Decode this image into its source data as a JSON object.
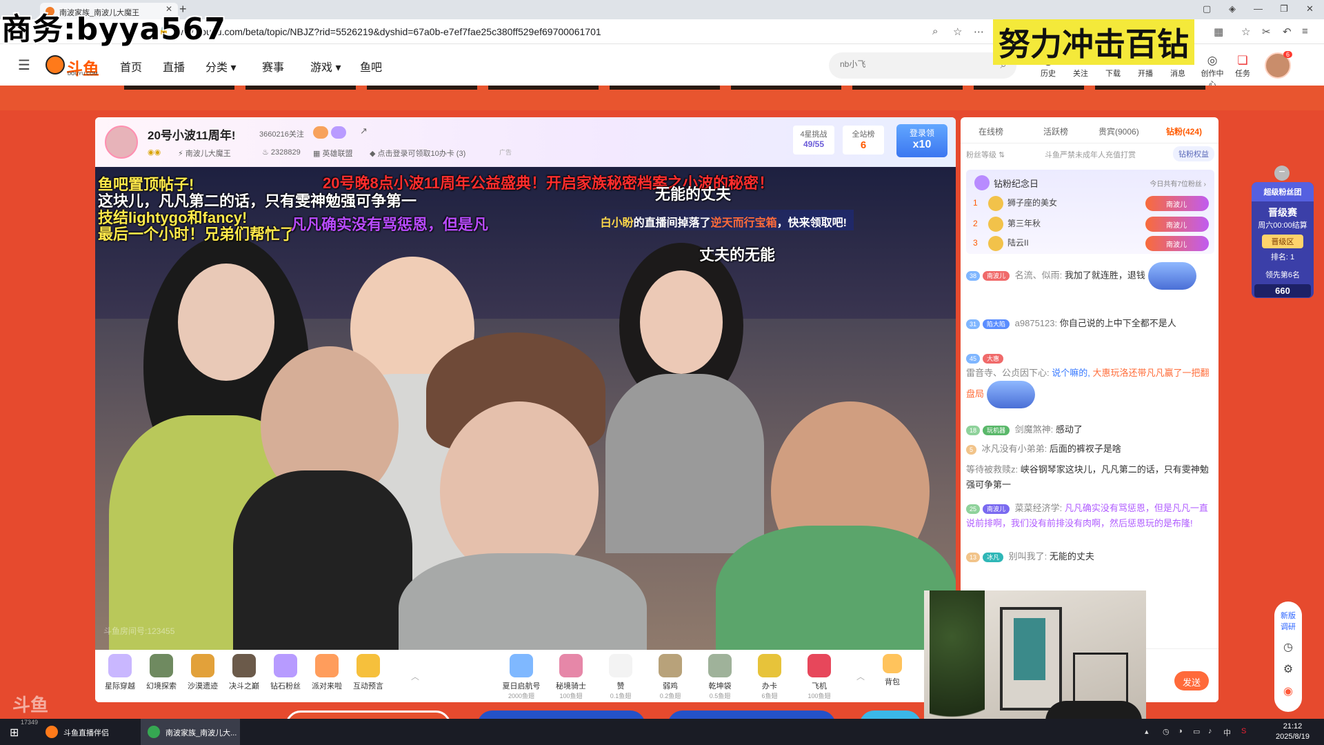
{
  "watermarks": {
    "top_left": "商务:byya567",
    "top_right": "努力冲击百钻"
  },
  "browser": {
    "tab_title": "南波家族_南波儿大魔王",
    "url": "www.douyu.com/beta/topic/NBJZ?rid=5526219&dyshid=67a0b-e7ef7fae25c380ff529ef69700061701"
  },
  "site": {
    "logo_text": "斗鱼",
    "logo_sub": "DOUYU.COM",
    "nav": [
      "首页",
      "直播",
      "分类",
      "赛事",
      "游戏",
      "鱼吧"
    ],
    "search_placeholder": "nb小飞",
    "header_icons": [
      {
        "label": "历史",
        "icon": "clock-icon"
      },
      {
        "label": "关注",
        "icon": "heart-icon"
      },
      {
        "label": "下载",
        "icon": "download-icon"
      },
      {
        "label": "开播",
        "icon": "broadcast-icon"
      },
      {
        "label": "消息",
        "icon": "bell-icon",
        "badge": "5"
      },
      {
        "label": "创作中心",
        "icon": "bulb-icon"
      },
      {
        "label": "任务",
        "icon": "gift-icon"
      }
    ],
    "avatar_badge": "6"
  },
  "room": {
    "title": "20号小波11周年!",
    "follows": "3660216关注",
    "anchor_name": "南波儿大魔王",
    "hot": "2328829",
    "category": "英雄联盟",
    "promo": "点击登录可领取10办卡 (3)",
    "ad": "广告",
    "stat1_label": "4星挑战",
    "stat1_value": "49/55",
    "stat2_label": "全站榜",
    "stat2_value": "6",
    "login_gift_label": "登录领",
    "login_gift_value": "x10"
  },
  "danmaku": [
    {
      "text": "鱼吧置顶帖子!",
      "style": "y"
    },
    {
      "text": "20号晚8点小波11周年公益盛典！开启家族秘密档案之小波的秘密！",
      "style": "r"
    },
    {
      "text": "这块儿，凡凡第二的话，只有雯神勉强可争第一",
      "style": "w"
    },
    {
      "text": "无能的丈夫",
      "style": "w"
    },
    {
      "text": "技结lightygo和fancy!",
      "style": "y"
    },
    {
      "text": "最后一个小时！兄弟们帮忙了",
      "style": "y"
    },
    {
      "text": "凡凡确实没有骂惩恩，但是凡",
      "style": "r"
    },
    {
      "text": "丈夫的无能",
      "style": "w"
    }
  ],
  "notify": {
    "user": "白小盼",
    "middle": "的直播间掉落了",
    "item": "逆天而行宝箱",
    "tail": "，快来领取吧!"
  },
  "video_watermark": "斗鱼房间号:123455",
  "gifts_left": [
    "星际穿越",
    "幻境探索",
    "沙漠遗迹",
    "决斗之巅",
    "钻石粉丝",
    "派对来啦",
    "互动预言"
  ],
  "gifts_right": [
    {
      "name": "夏日启航号",
      "price": "2000鱼翅"
    },
    {
      "name": "秘境骑士",
      "price": "100鱼翅"
    },
    {
      "name": "赞",
      "price": "0.1鱼翅"
    },
    {
      "name": "弱鸡",
      "price": "0.2鱼翅"
    },
    {
      "name": "乾坤袋",
      "price": "0.5鱼翅"
    },
    {
      "name": "办卡",
      "price": "6鱼翅"
    },
    {
      "name": "飞机",
      "price": "100鱼翅"
    }
  ],
  "backpack": "背包",
  "chat": {
    "tabs": [
      "在线榜",
      "活跃榜",
      "贵宾(9006)",
      "钻粉(424)"
    ],
    "fan_level": "粉丝等级 ⇅",
    "fan_notice": "斗鱼严禁未成年人充值打赏",
    "fan_button": "钻粉权益",
    "anniv_title": "钻粉纪念日",
    "anniv_note": "今日共有7位粉丝 ›",
    "ranks": [
      {
        "n": "1",
        "name": "狮子座的美女"
      },
      {
        "n": "2",
        "name": "第三年秋"
      },
      {
        "n": "3",
        "name": "陆云II"
      }
    ],
    "rank_badge": "南波儿",
    "messages": [
      {
        "lv": "38",
        "fan": "南波儿",
        "name": "名流、似雨:",
        "text": "我加了就连胜，退钱"
      },
      {
        "lv": "31",
        "fan": "陷大陷",
        "name": "a9875123:",
        "text": "你自己说的上中下全都不是人"
      },
      {
        "lv": "45",
        "fan": "大惠",
        "name": "雷音寺、公贞因下心:",
        "text_blue": "说个嘛的,",
        "text_orange": "大惠玩洛还带凡凡赢了一把翻盘局"
      },
      {
        "lv": "18",
        "fan": "玩机器",
        "name": "剑魔煞神:",
        "text": "感动了"
      },
      {
        "lv": "5",
        "fan": "",
        "name": "冰凡没有小弟弟:",
        "text": "后面的裤衩子是啥"
      },
      {
        "lv": "",
        "fan": "",
        "name": "等待被救赎z:",
        "text": "峡谷钢琴家这块儿，凡凡第二的话，只有雯神勉强可争第一"
      },
      {
        "lv": "25",
        "fan": "南波儿",
        "name": "菜菜经济学:",
        "text": "凡凡确实没有骂惩恩，但是凡凡一直说前排啊，我们没有前排没有肉啊，然后惩恩玩的是布隆!"
      },
      {
        "lv": "13",
        "fan": "冰凡",
        "name": "别叫我了:",
        "text": "无能的丈夫"
      }
    ],
    "send": "发送"
  },
  "float_rank": {
    "title": "超级粉丝团",
    "stage": "晋级赛",
    "time": "周六00:00结算",
    "zone": "晋级区",
    "rank": "排名: 1",
    "lead": "领先第6名",
    "lead_value": "660"
  },
  "taskbar": {
    "items": [
      "斗鱼直播伴侣",
      "南波家族_南波儿大..."
    ],
    "count": "17349",
    "time": "21:12",
    "date": "2025/8/19",
    "ime": "中"
  },
  "colors": {
    "accent": "#ff5a00",
    "page_bg": "#e64a2e",
    "taskbar": "#1a1c25"
  }
}
